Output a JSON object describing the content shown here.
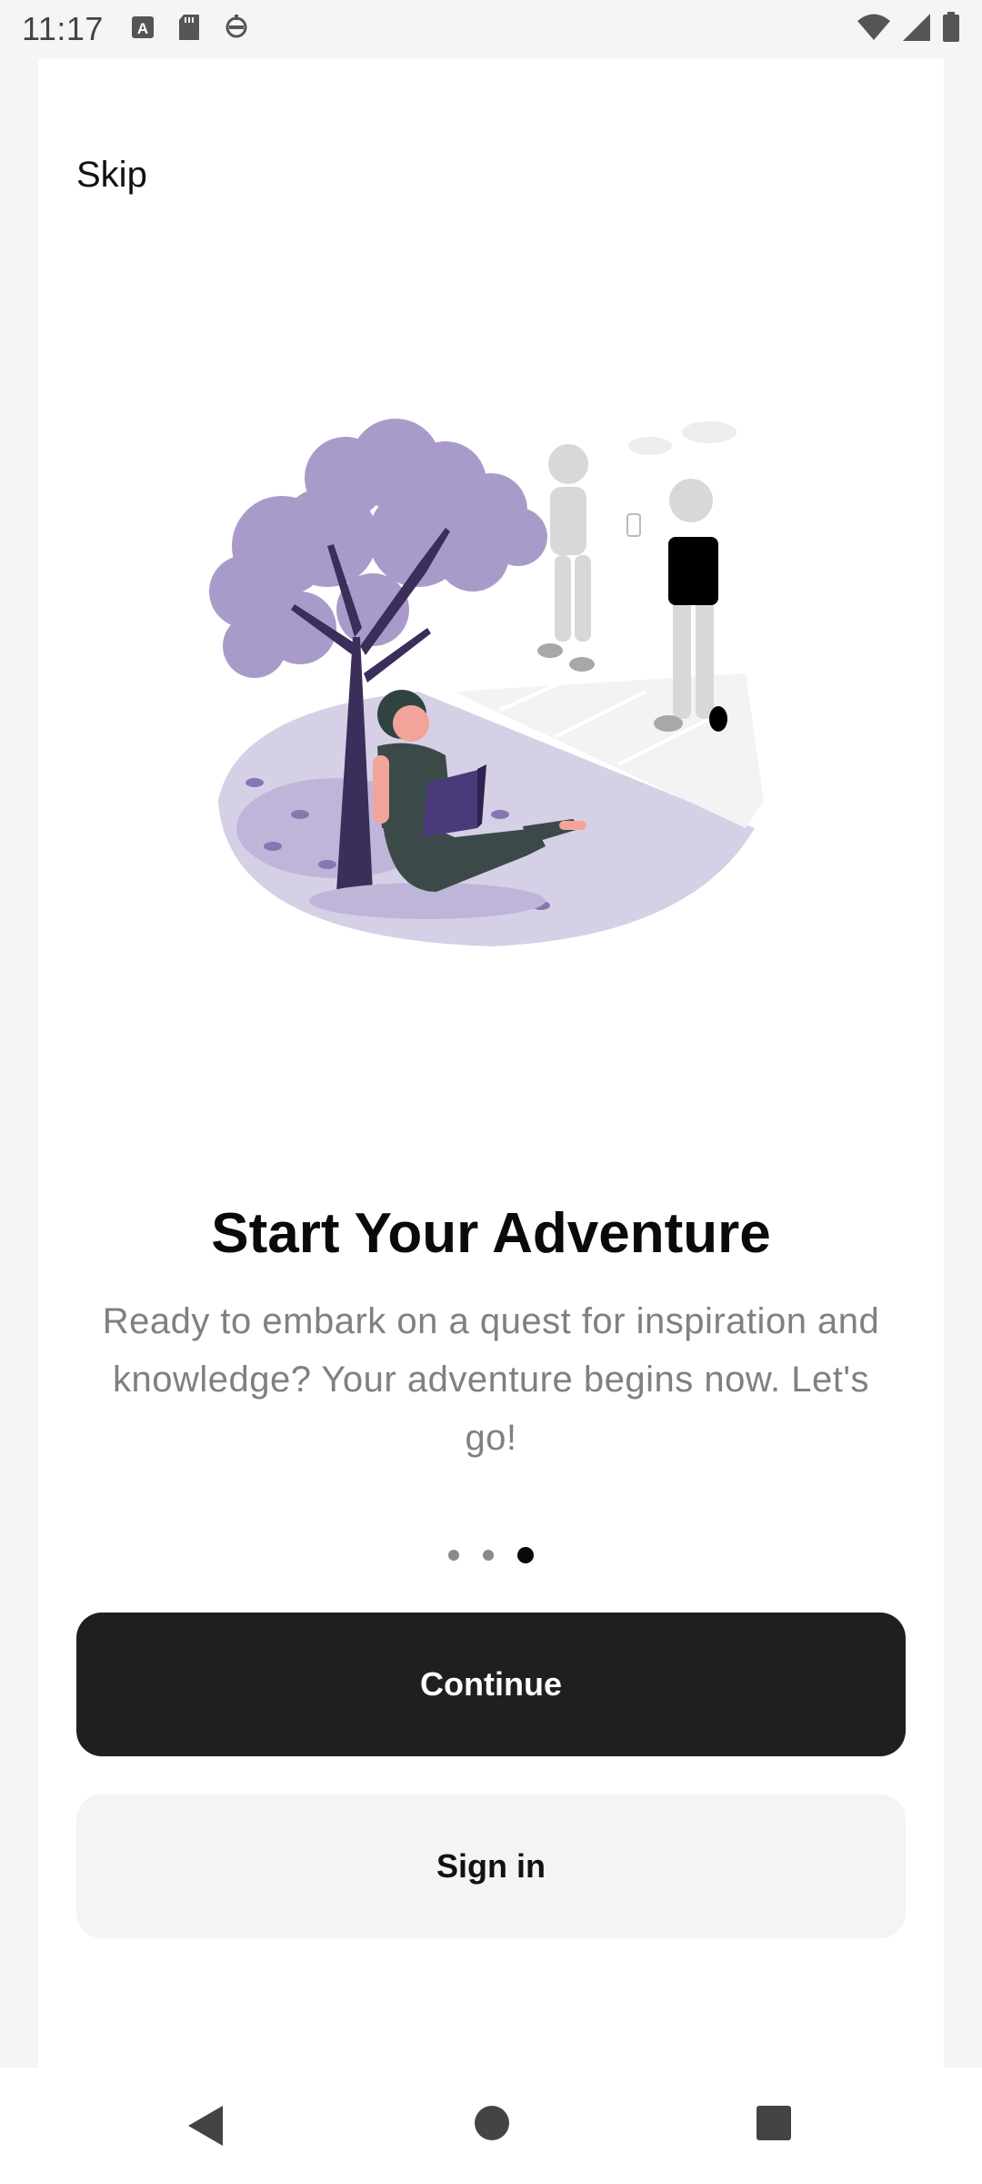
{
  "status_bar": {
    "time": "11:17",
    "left_icons": [
      "text-notification-icon",
      "sd-card-icon",
      "sync-icon"
    ],
    "right_icons": [
      "wifi-icon",
      "signal-icon",
      "battery-icon"
    ]
  },
  "header": {
    "skip_label": "Skip"
  },
  "onboarding": {
    "title": "Start Your Adventure",
    "description": "Ready to embark on a quest for inspiration and knowledge? Your adventure begins now. Let's go!",
    "page_index": 3,
    "page_count": 3,
    "illustration": "person-reading-under-tree-illustration",
    "accent_color": "#a99bc9"
  },
  "actions": {
    "continue_label": "Continue",
    "signin_label": "Sign in"
  },
  "nav_bar": {
    "buttons": [
      "back-icon",
      "home-icon",
      "recents-icon"
    ]
  }
}
